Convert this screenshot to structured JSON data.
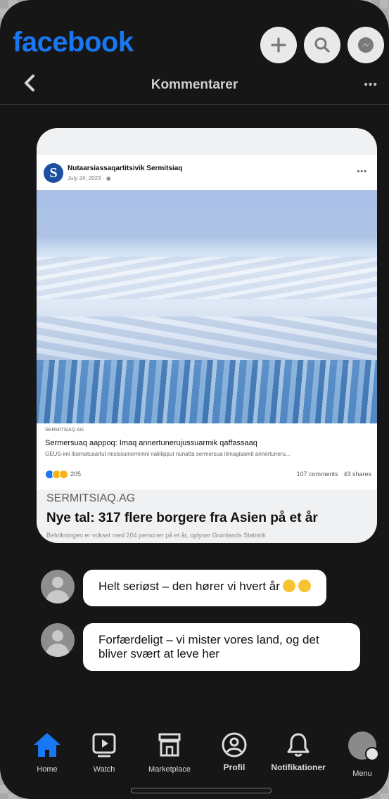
{
  "app": {
    "logo": "facebook"
  },
  "subheader": {
    "title": "Kommentarer",
    "more": "•••"
  },
  "post": {
    "page_name": "Nutaarsiassaqartitsivik Sermitsiaq",
    "date": "July 24, 2023 · ",
    "avatar_letter": "S",
    "more": "•••",
    "link_source": "SERMITSIAQ.AG",
    "link_title": "Sermersuaq aappoq: Imaq annertunerujussuarmik qaffassaaq",
    "link_desc": "GEUS-imi ilisimatusartut misissuinerminni naliliipput nunatta sermersua ilimagisamit annertuneru...",
    "reaction_count": "205",
    "comments": "107 comments",
    "shares": "43 shares"
  },
  "shared_link": {
    "source": "SERMITSIAQ.AG",
    "title": "Nye tal: 317 flere borgere fra Asien på et år",
    "description": "Befolkningen er vokset med 204 personer på et år, oplyser Grønlands Statistik"
  },
  "comments": [
    {
      "text": "Helt seriøst – den hører vi hvert år"
    },
    {
      "text": "Forfærdeligt – vi mister vores land, og det bliver svært at leve her"
    }
  ],
  "nav": {
    "home": "Home",
    "watch": "Watch",
    "marketplace": "Marketplace",
    "profile": "Profil",
    "notifications": "Notifikationer",
    "menu": "Menu"
  },
  "colors": {
    "brand": "#1877f2",
    "background": "#161616"
  }
}
